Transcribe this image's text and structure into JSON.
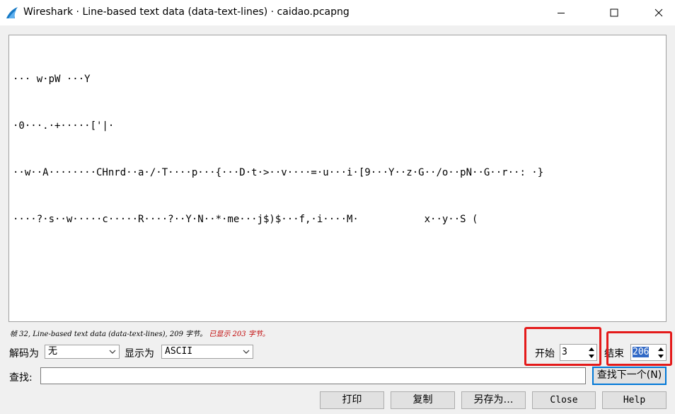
{
  "window": {
    "title": "Wireshark · Line-based text data (data-text-lines) · caidao.pcapng",
    "icon": "shark-fin-icon"
  },
  "text_lines": [
    "··· w·pW ···Y",
    "·0···.·+·····['|·",
    "··w··A········CHnrd··a·/·T····p···{···D·t·>··v····=·u···i·[9···Y··z·G··/o··pN··G··r··: ·}",
    "····?·s··w·····c·····R····?··Y·N··*·me···j$)$···f,·i····M·           x··y··S ("
  ],
  "status": {
    "prefix": "帧 32, Line-based text data (data-text-lines), 209 字节。",
    "highlight": " 已显示 203 字节。"
  },
  "decode": {
    "label": "解码为",
    "value": "无"
  },
  "show_as": {
    "label": "显示为",
    "value": "ASCII"
  },
  "start": {
    "label": "开始",
    "value": "3"
  },
  "end": {
    "label": "结束",
    "value": "206"
  },
  "find": {
    "label": "查找:",
    "value": "",
    "next_button": "查找下一个(N)"
  },
  "buttons": {
    "print": "打印",
    "copy": "复制",
    "save_as": "另存为…",
    "close": "Close",
    "help": "Help"
  },
  "colors": {
    "highlight_box": "#e41a1a",
    "status_highlight": "#c00000",
    "selection": "#3169c6"
  }
}
